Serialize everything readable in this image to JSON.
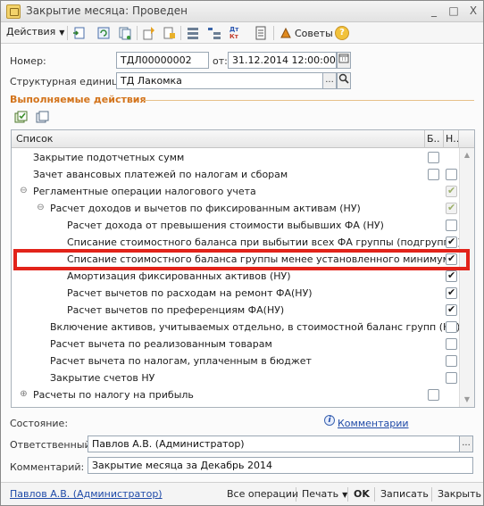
{
  "window": {
    "title": "Закрытие месяца: Проведен",
    "controls": [
      "_",
      "□",
      "X"
    ]
  },
  "toolbar": {
    "actions_label": "Действия",
    "icons": [
      "post-and-close-icon",
      "refresh-icon",
      "copy-icon",
      "structure-icon",
      "print-icon",
      "list-icon",
      "tree-icon",
      "dt-kt-icon",
      "document-icon"
    ],
    "dt_label": "Дт",
    "kt_label": "Кт",
    "soveti_label": "Советы",
    "help_label": "?"
  },
  "form": {
    "number_label": "Номер:",
    "number_value": "ТДЛ00000002",
    "from_label": "от:",
    "date_value": "31.12.2014 12:00:00",
    "unit_label": "Структурная единица:",
    "unit_value": "ТД Лакомка",
    "unit_btn_dots": "...",
    "section_title": "Выполняемые действия"
  },
  "table": {
    "col_list": "Список",
    "col_b": "Б..",
    "col_n": "Н..",
    "rows": [
      {
        "text": "Закрытие подотчетных сумм",
        "indent": 1,
        "b": "unchecked",
        "n": "none"
      },
      {
        "text": "Зачет авансовых платежей по налогам и сборам",
        "indent": 1,
        "b": "unchecked",
        "n": "unchecked"
      },
      {
        "text": "Регламентные операции налогового учета",
        "indent": 1,
        "toggle": "⊖",
        "b": "none",
        "n": "disabled-checked"
      },
      {
        "text": "Расчет доходов и вычетов по фиксированным активам (НУ)",
        "indent": 2,
        "toggle": "⊖",
        "b": "none",
        "n": "disabled-checked"
      },
      {
        "text": "Расчет дохода от превышения стоимости выбывших ФА (НУ)",
        "indent": 3,
        "b": "none",
        "n": "unchecked"
      },
      {
        "text": "Списание стоимостного баланса при выбытии всех ФА группы (подгруппы)",
        "indent": 3,
        "b": "none",
        "n": "checked"
      },
      {
        "text": "Списание стоимостного баланса группы менее установленного минимума",
        "indent": 3,
        "b": "none",
        "n": "checked"
      },
      {
        "text": "Амортизация фиксированных активов (НУ)",
        "indent": 3,
        "b": "none",
        "n": "checked"
      },
      {
        "text": "Расчет вычетов по расходам на ремонт ФА(НУ)",
        "indent": 3,
        "b": "none",
        "n": "checked"
      },
      {
        "text": "Расчет вычетов по преференциям ФА(НУ)",
        "indent": 3,
        "b": "none",
        "n": "checked"
      },
      {
        "text": "Включение активов, учитываемых отдельно, в стоимостной баланс групп (НУ)",
        "indent": 2,
        "b": "none",
        "n": "unchecked"
      },
      {
        "text": "Расчет вычета по реализованным товарам",
        "indent": 2,
        "b": "none",
        "n": "unchecked"
      },
      {
        "text": "Расчет вычета по налогам, уплаченным в бюджет",
        "indent": 2,
        "b": "none",
        "n": "unchecked"
      },
      {
        "text": "Закрытие счетов НУ",
        "indent": 2,
        "b": "none",
        "n": "unchecked"
      },
      {
        "text": "Расчеты по налогу на прибыль",
        "indent": 1,
        "toggle": "⊕",
        "b": "unchecked",
        "n": "none"
      }
    ]
  },
  "footer": {
    "state_label": "Состояние:",
    "comments_link": "Комментарии",
    "responsible_label": "Ответственный:",
    "responsible_value": "Павлов А.В. (Администратор)",
    "responsible_dots": "...",
    "comment_label": "Комментарий:",
    "comment_value": "Закрытие месяца за Декабрь 2014"
  },
  "statusbar": {
    "user_link": "Павлов А.В. (Администратор)",
    "all_ops": "Все операции",
    "print": "Печать",
    "ok": "OK",
    "write": "Записать",
    "close": "Закрыть"
  },
  "colors": {
    "section_title": "#d3731a",
    "highlight_border": "#e2231a",
    "link": "#1f4aa8"
  }
}
